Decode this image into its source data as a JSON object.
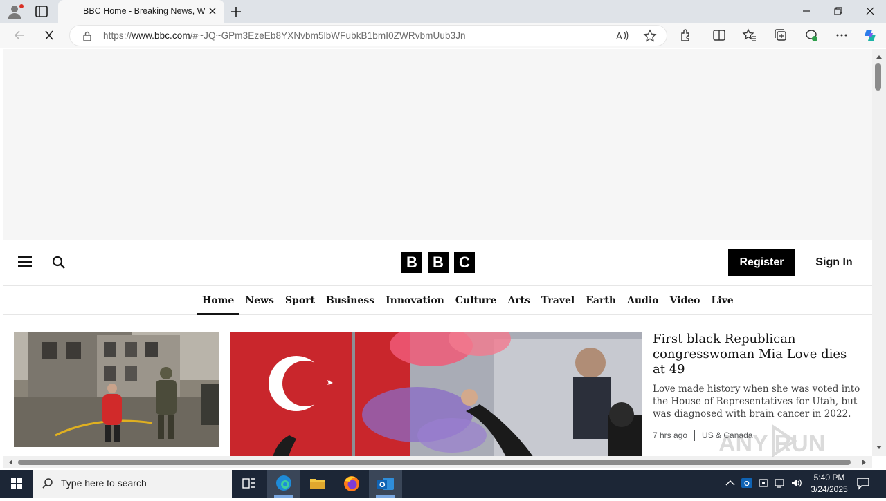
{
  "browser": {
    "tab_title": "BBC Home - Breaking News, World News, US News, Sports, Business, Innovation, Climate, Culture, Travel, Video & Audio",
    "url_prefix": "https://",
    "url_host": "www.bbc.com",
    "url_rest": "/#~JQ~GPm3EzeEb8YXNvbm5lbWFubkB1bmI0ZWRvbmUub3Jn"
  },
  "page": {
    "masthead": {
      "register_label": "Register",
      "signin_label": "Sign In",
      "logo_letters": [
        "B",
        "B",
        "C"
      ]
    },
    "nav": [
      {
        "label": "Home",
        "active": true
      },
      {
        "label": "News"
      },
      {
        "label": "Sport"
      },
      {
        "label": "Business"
      },
      {
        "label": "Innovation"
      },
      {
        "label": "Culture"
      },
      {
        "label": "Arts"
      },
      {
        "label": "Travel"
      },
      {
        "label": "Earth"
      },
      {
        "label": "Audio"
      },
      {
        "label": "Video"
      },
      {
        "label": "Live"
      }
    ],
    "lead_story": {
      "headline": "First black Republican congresswoman Mia Love dies at 49",
      "summary": "Love made history when she was voted into the House of Representatives for Utah, but was diagnosed with brain cancer in 2022.",
      "time": "7 hrs ago",
      "section": "US & Canada"
    }
  },
  "watermark": "ANY RUN",
  "taskbar": {
    "search_placeholder": "Type here to search",
    "time": "5:40 PM",
    "date": "3/24/2025"
  },
  "colors": {
    "bbc_black": "#000000",
    "taskbar": "#1c2636",
    "chrome": "#dfe3e8"
  }
}
